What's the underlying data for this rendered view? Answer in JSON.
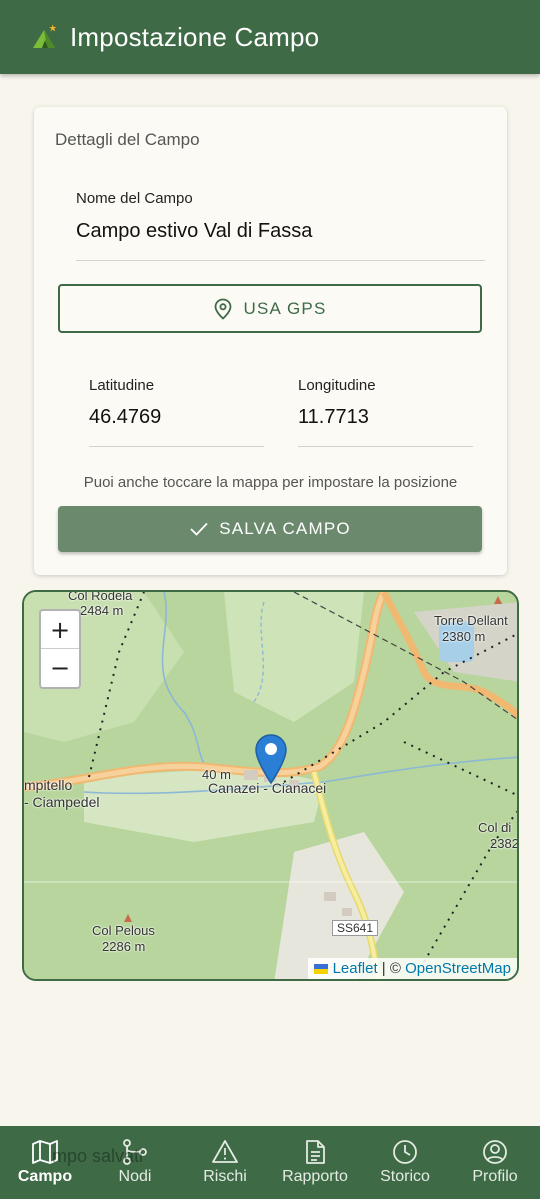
{
  "app": {
    "title": "Impostazione Campo"
  },
  "card": {
    "heading": "Dettagli del Campo",
    "name_label": "Nome del Campo",
    "name_value": "Campo estivo Val di Fassa",
    "gps_button": "USA GPS",
    "lat_label": "Latitudine",
    "lat_value": "46.4769",
    "lon_label": "Longitudine",
    "lon_value": "11.7713",
    "hint": "Puoi anche toccare la mappa per impostare la posizione",
    "save_button": "SALVA CAMPO"
  },
  "map": {
    "zoom_in": "+",
    "zoom_out": "−",
    "attribution_leaflet": "Leaflet",
    "attribution_sep": " | © ",
    "attribution_osm": "OpenStreetMap",
    "labels": {
      "col_rodela": "Col Rodela",
      "col_rodela_alt": "2484 m",
      "torre": "Torre Dellant",
      "torre_alt": "2380 m",
      "campitello": "mpitello",
      "ciampedel": "- Ciampedel",
      "alt_40": "40 m",
      "canazei": "Canazei - Cianacei",
      "col_di": "Col di",
      "col_di_alt": "2382",
      "col_pelous": "Col Pelous",
      "col_pelous_alt": "2286 m",
      "road": "SS641"
    }
  },
  "ghost_text": "mpo salvati",
  "nav": {
    "items": [
      {
        "label": "Campo",
        "icon": "map-icon"
      },
      {
        "label": "Nodi",
        "icon": "nodes-icon"
      },
      {
        "label": "Rischi",
        "icon": "warning-icon"
      },
      {
        "label": "Rapporto",
        "icon": "document-icon"
      },
      {
        "label": "Storico",
        "icon": "clock-icon"
      },
      {
        "label": "Profilo",
        "icon": "profile-icon"
      }
    ],
    "active": "Campo"
  },
  "colors": {
    "primary": "#3e6b46",
    "save_button": "#6b8a6d",
    "background": "#f7f5ec",
    "map_forest": "#b6d49a",
    "map_road": "#f5c98a",
    "marker": "#2a7fd4"
  }
}
